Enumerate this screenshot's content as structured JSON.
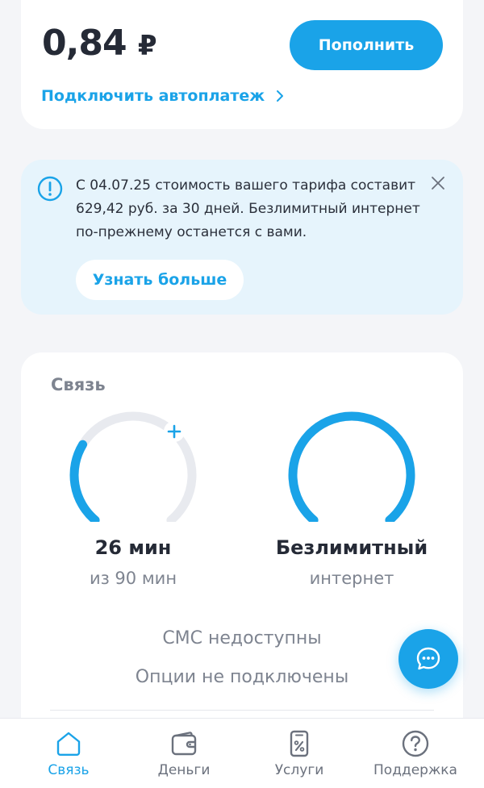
{
  "balance": {
    "amount": "0,84",
    "currency": "₽",
    "topup_label": "Пополнить",
    "autopay_label": "Подключить автоплатеж"
  },
  "notice": {
    "text": "С 04.07.25 стоимость вашего тарифа составит 629,42 руб. за 30 дней. Безлимитный интернет по-прежнему останется с вами.",
    "learn_more_label": "Узнать больше",
    "icon": "exclamation-circle-icon",
    "close_icon": "close-icon"
  },
  "connection": {
    "title": "Связь",
    "minutes": {
      "value": "26 мин",
      "sub": "из 90 мин",
      "fraction_remaining": 0.29
    },
    "internet": {
      "value": "Безлимитный",
      "sub": "интернет",
      "fraction_remaining": 1.0
    },
    "sms_status": "СМС недоступны",
    "options_status": "Опции не подключены"
  },
  "bottom_nav": {
    "items": [
      {
        "label": "Связь",
        "icon": "home-icon",
        "active": true
      },
      {
        "label": "Деньги",
        "icon": "wallet-icon",
        "active": false
      },
      {
        "label": "Услуги",
        "icon": "services-icon",
        "active": false
      },
      {
        "label": "Поддержка",
        "icon": "help-icon",
        "active": false
      }
    ]
  },
  "colors": {
    "accent": "#1aa3e8",
    "track": "#e8eaef",
    "notice_bg": "#e6f4fc",
    "page_bg": "#f4f5f8"
  }
}
